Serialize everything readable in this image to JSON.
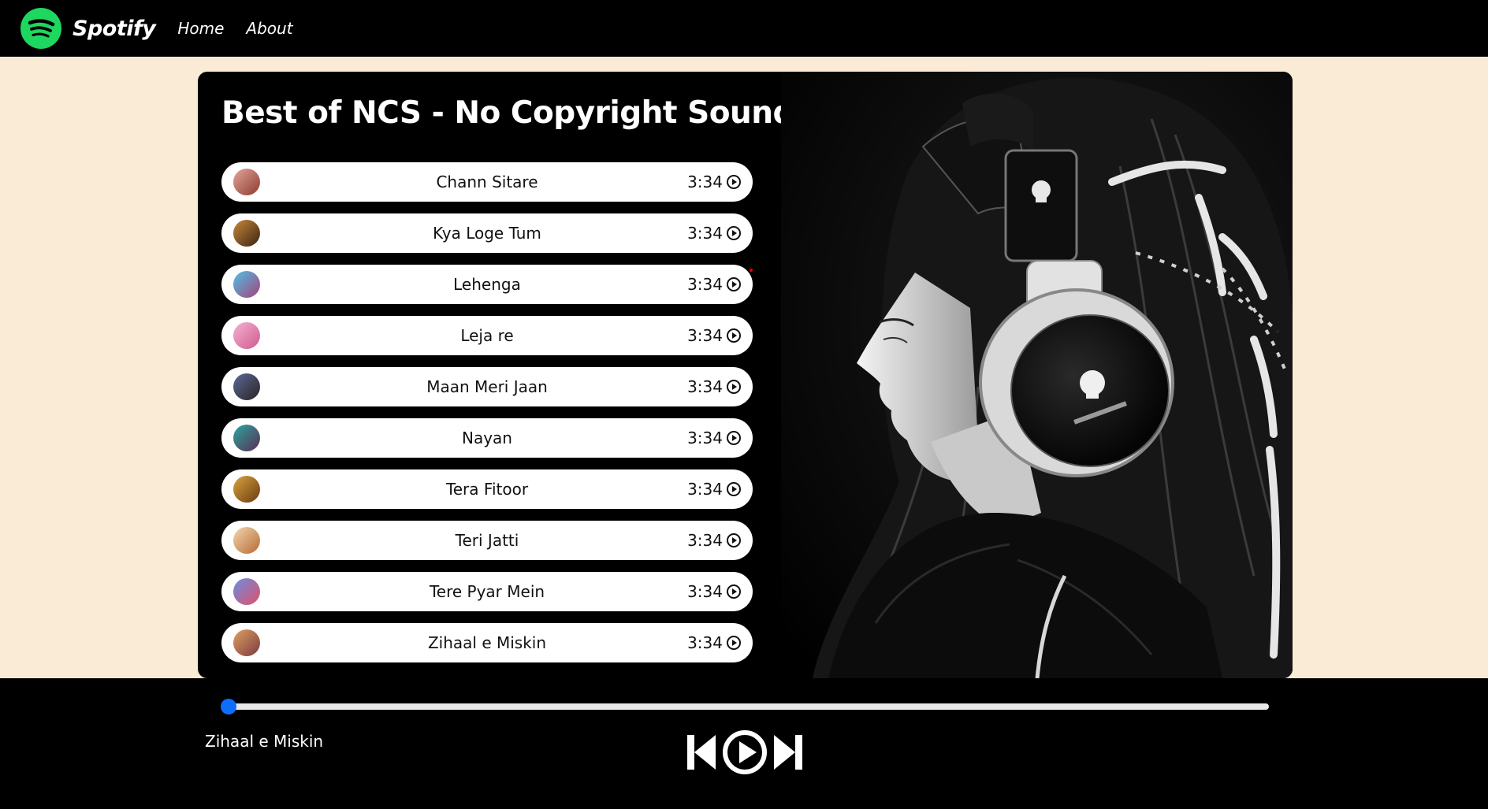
{
  "nav": {
    "brand": "Spotify",
    "links": [
      "Home",
      "About"
    ],
    "logo_color": "#1ed760"
  },
  "playlist": {
    "title": "Best of NCS - No Copyright Sounds",
    "songs": [
      {
        "name": "Chann Sitare",
        "duration": "3:34",
        "thumb_colors": [
          "#e6a59b",
          "#8b3b2e"
        ]
      },
      {
        "name": "Kya Loge Tum",
        "duration": "3:34",
        "thumb_colors": [
          "#c98a3a",
          "#3a2110"
        ]
      },
      {
        "name": "Lehenga",
        "duration": "3:34",
        "thumb_colors": [
          "#4fc2e8",
          "#a6407a"
        ]
      },
      {
        "name": "Leja re",
        "duration": "3:34",
        "thumb_colors": [
          "#f5b2cf",
          "#d05a8f"
        ]
      },
      {
        "name": "Maan Meri Jaan",
        "duration": "3:34",
        "thumb_colors": [
          "#5a6a9a",
          "#2b2320"
        ]
      },
      {
        "name": "Nayan",
        "duration": "3:34",
        "thumb_colors": [
          "#2aa7a0",
          "#5b2c52"
        ]
      },
      {
        "name": "Tera Fitoor",
        "duration": "3:34",
        "thumb_colors": [
          "#d9a43c",
          "#6b3a12"
        ]
      },
      {
        "name": "Teri Jatti",
        "duration": "3:34",
        "thumb_colors": [
          "#f3d7b0",
          "#b66a35"
        ]
      },
      {
        "name": "Tere Pyar Mein",
        "duration": "3:34",
        "thumb_colors": [
          "#6a8fe0",
          "#e0506a"
        ]
      },
      {
        "name": "Zihaal e Miskin",
        "duration": "3:34",
        "thumb_colors": [
          "#e0a060",
          "#7a3a40"
        ]
      }
    ]
  },
  "player": {
    "now_playing": "Zihaal e Miskin",
    "progress": 0,
    "accent": "#0d6efd",
    "controls": [
      "skip-back-icon",
      "play-icon",
      "skip-forward-icon"
    ]
  },
  "colors": {
    "page_bg": "#faebd7",
    "panel_bg": "#000000",
    "row_bg": "#ffffff"
  }
}
